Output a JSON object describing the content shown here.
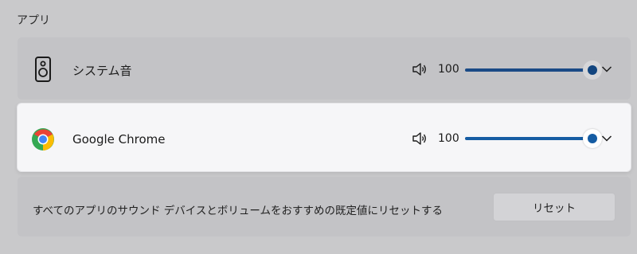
{
  "section": {
    "title": "アプリ"
  },
  "apps": [
    {
      "name": "システム音",
      "icon": "speaker-device-icon",
      "volume": "100",
      "level": 1.0
    },
    {
      "name": "Google Chrome",
      "icon": "chrome-icon",
      "volume": "100",
      "level": 1.0
    }
  ],
  "reset": {
    "description": "すべてのアプリのサウンド デバイスとボリュームをおすすめの既定値にリセットする",
    "button_label": "リセット"
  },
  "colors": {
    "accent": "#155ca3",
    "accent_dim": "#1a4a86",
    "background": "#c9c9cb",
    "focused_card": "#f6f6f8"
  }
}
